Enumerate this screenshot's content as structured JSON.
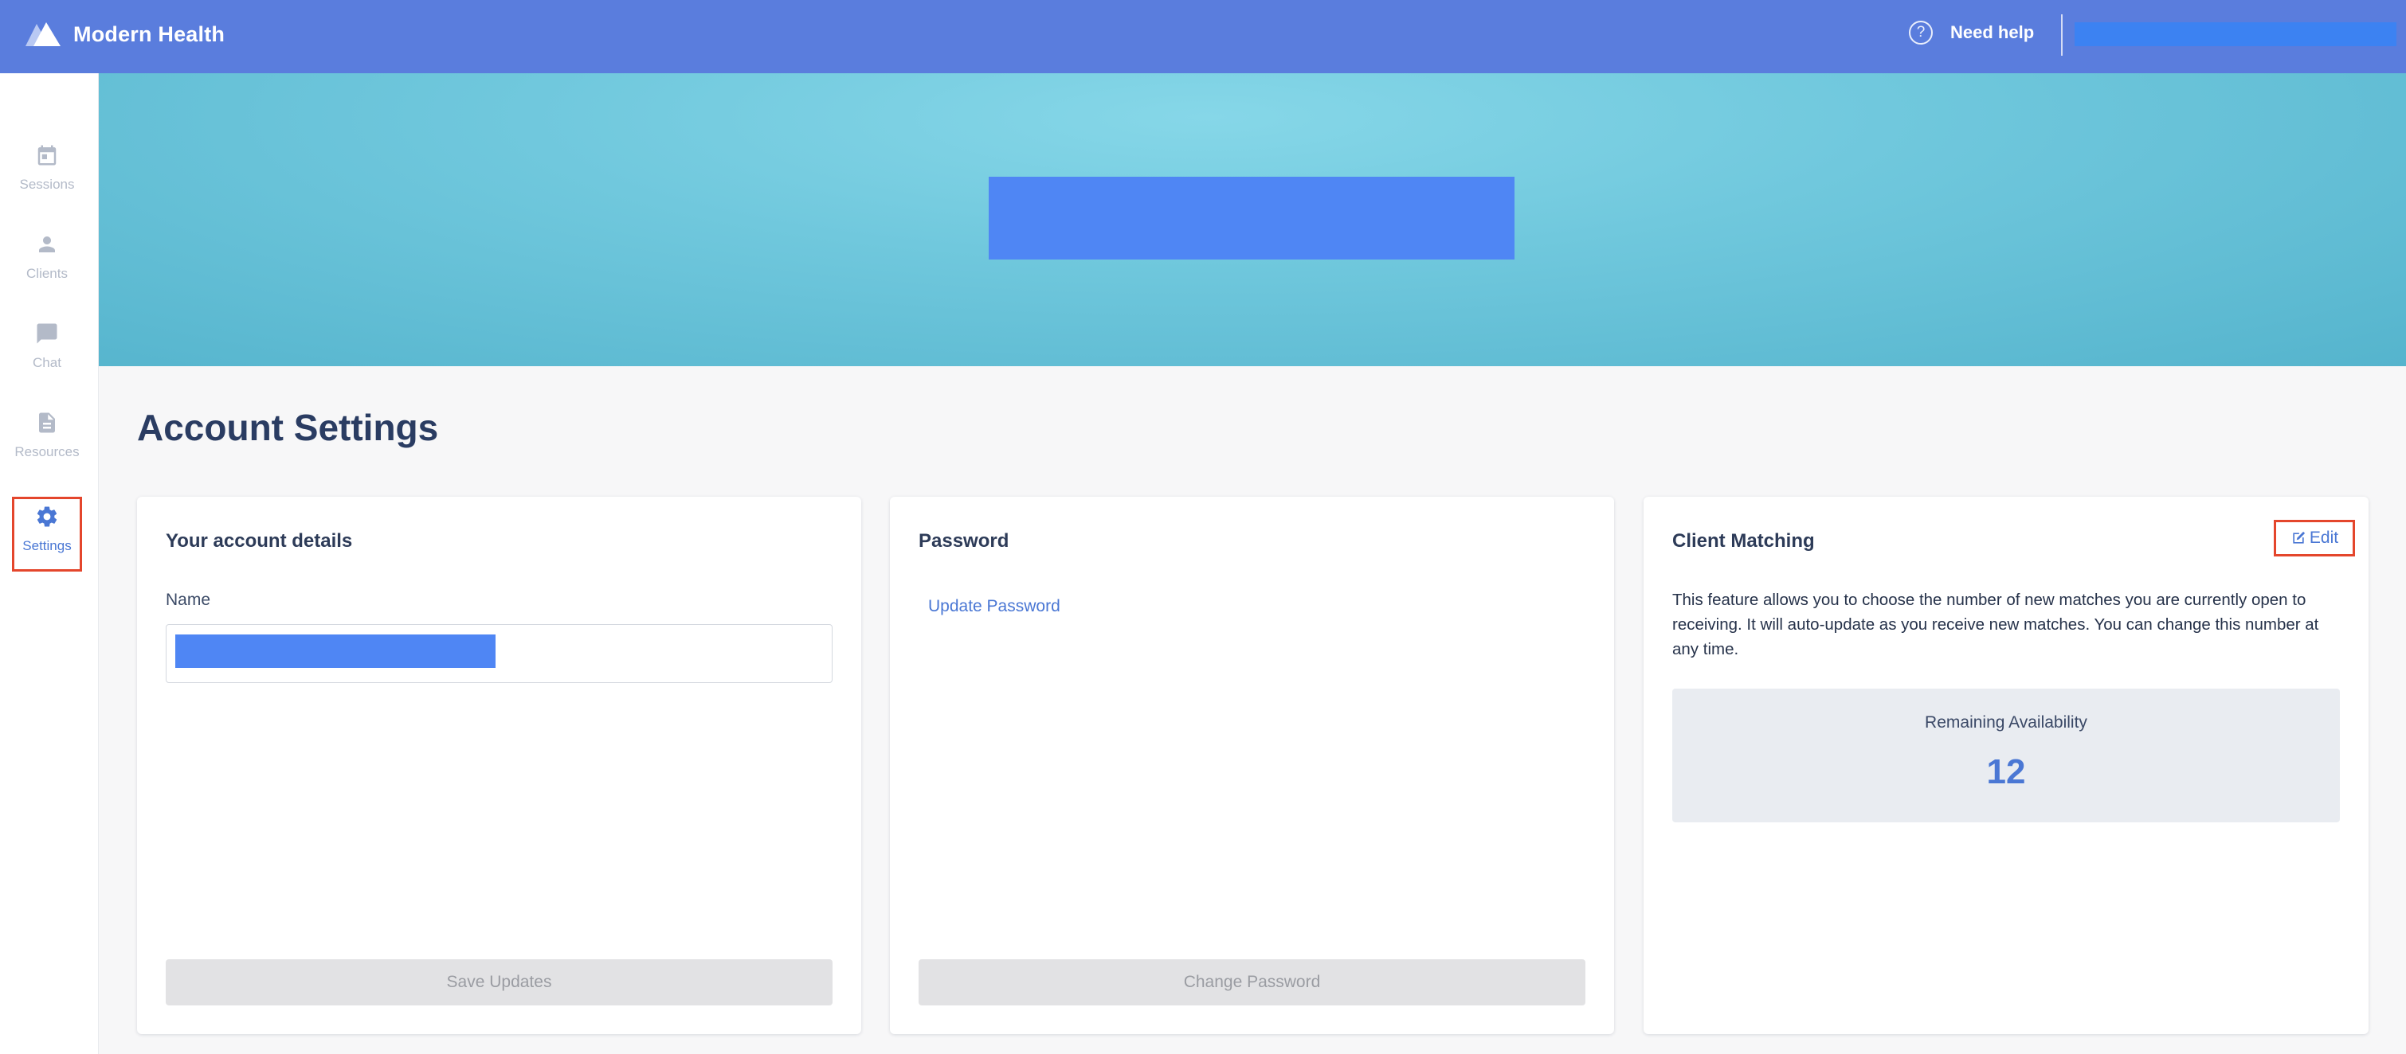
{
  "header": {
    "brand_name": "Modern Health",
    "help_label": "Need help",
    "help_icon": "question-circle-icon"
  },
  "sidebar": {
    "items": [
      {
        "label": "Sessions",
        "icon": "calendar-icon"
      },
      {
        "label": "Clients",
        "icon": "person-icon"
      },
      {
        "label": "Chat",
        "icon": "chat-bubble-icon"
      },
      {
        "label": "Resources",
        "icon": "document-icon"
      },
      {
        "label": "Settings",
        "icon": "gear-icon",
        "active": true
      }
    ]
  },
  "page": {
    "title": "Account Settings"
  },
  "account_card": {
    "title": "Your account details",
    "name_label": "Name",
    "save_label": "Save Updates"
  },
  "password_card": {
    "title": "Password",
    "update_link": "Update Password",
    "change_label": "Change Password"
  },
  "matching_card": {
    "title": "Client Matching",
    "edit_label": "Edit",
    "description": "This feature allows you to choose the number of new matches you are currently open to receiving. It will auto-update as you receive new matches. You can change this number at any time.",
    "availability_label": "Remaining Availability",
    "availability_count": "12"
  },
  "colors": {
    "topbar": "#5a7ddd",
    "accent": "#4a77d4",
    "highlight_outline": "#e4462c",
    "redaction": "#4f86f4"
  }
}
